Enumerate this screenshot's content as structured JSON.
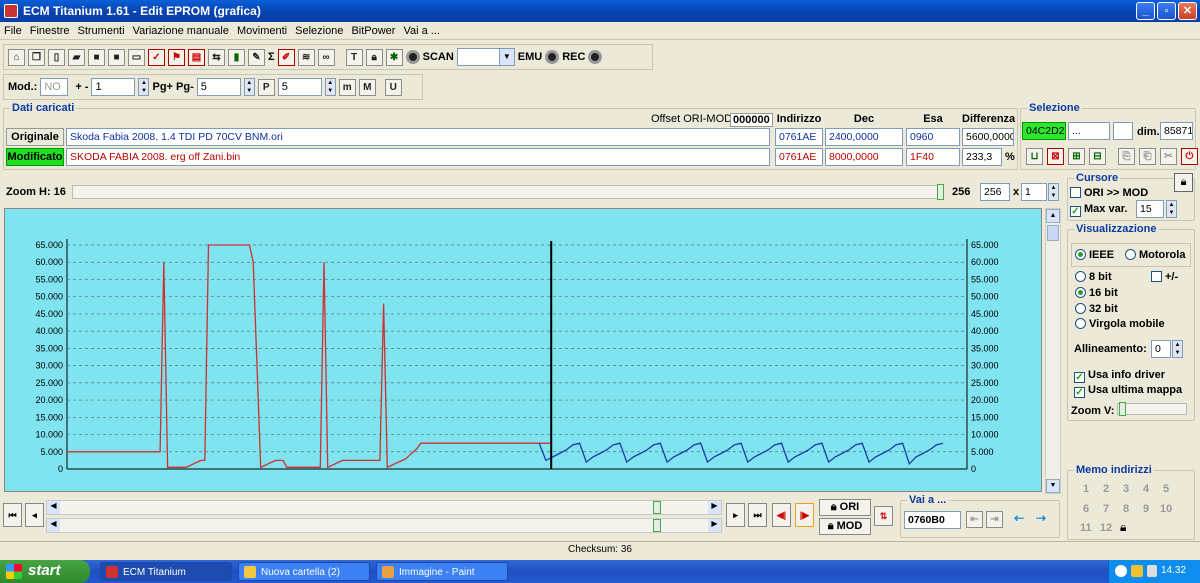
{
  "window": {
    "title": "ECM Titanium 1.61 - Edit EPROM (grafica)"
  },
  "menu": [
    "File",
    "Finestre",
    "Strumenti",
    "Variazione manuale",
    "Movimenti",
    "Selezione",
    "BitPower",
    "Vai a ..."
  ],
  "toolbar1": {
    "scan": "SCAN",
    "emu": "EMU",
    "rec": "REC",
    "sigma": "Σ"
  },
  "toolbar2": {
    "mod_label": "Mod.:",
    "mod_value": "NO",
    "plusminus": "+ -",
    "step_value": "1",
    "pg_label": "Pg+ Pg-",
    "pg_value": "5",
    "p_value": "5",
    "m_btn": "m",
    "M_btn": "M",
    "U_btn": "U",
    "P_btn": "P"
  },
  "dati": {
    "title": "Dati caricati",
    "offset_label": "Offset ORI-MOD",
    "offset_value": "000000",
    "headers": {
      "indirizzo": "Indirizzo",
      "dec": "Dec",
      "esa": "Esa",
      "diff": "Differenza"
    },
    "originale": {
      "label": "Originale",
      "file": "Skoda Fabia 2008. 1.4 TDI PD 70CV BNM.ori",
      "addr": "0761AE",
      "dec": "2400,0000",
      "esa": "0960",
      "diff": "5600,0000"
    },
    "modificato": {
      "label": "Modificato",
      "file": "SKODA FABIA 2008. erg off Zani.bin",
      "addr": "0761AE",
      "dec": "8000,0000",
      "esa": "1F40",
      "diff": "233,3",
      "pct": "%"
    }
  },
  "selezione": {
    "title": "Selezione",
    "start": "04C2D2",
    "end": "...",
    "dim_label": "dim.",
    "dim_value": "85871"
  },
  "zoom": {
    "label": "Zoom H: 16",
    "value": "256",
    "field": "256",
    "times": "x",
    "mult": "1"
  },
  "cursore": {
    "title": "Cursore",
    "ori_mod": "ORI >> MOD",
    "maxvar": "Max var.",
    "maxvar_value": "15"
  },
  "visualizzazione": {
    "title": "Visualizzazione",
    "ieee": "IEEE",
    "motorola": "Motorola",
    "b8": "8 bit",
    "pm": "+/-",
    "b16": "16 bit",
    "b32": "32 bit",
    "virgola": "Virgola mobile",
    "allineamento": "Allineamento:",
    "allineamento_value": "0",
    "usa_info": "Usa info driver",
    "usa_mappa": "Usa ultima mappa",
    "zoomv": "Zoom V:"
  },
  "memo": {
    "title": "Memo indirizzi",
    "numbers": [
      "1",
      "2",
      "3",
      "4",
      "5",
      "6",
      "7",
      "8",
      "9",
      "10",
      "11",
      "12"
    ]
  },
  "bottom": {
    "ori": "ORI",
    "mod": "MOD",
    "vai_title": "Vai a ...",
    "vai_value": "0760B0"
  },
  "status": {
    "checksum": "Checksum: 36"
  },
  "taskbar": {
    "start": "start",
    "tasks": [
      "ECM Titanium",
      "Nuova cartella (2)",
      "Immagine - Paint"
    ],
    "clock": "14.32"
  },
  "chart_data": {
    "type": "line",
    "ylim": [
      0,
      65000
    ],
    "y_ticks": [
      "0",
      "5.000",
      "10.000",
      "15.000",
      "20.000",
      "25.000",
      "30.000",
      "35.000",
      "40.000",
      "45.000",
      "50.000",
      "55.000",
      "60.000",
      "65.000"
    ],
    "colors": {
      "original": "#d03030",
      "modified": "#1a3aa8",
      "cursor": "#000000",
      "grid": "#4a7a80"
    },
    "cursor_fraction": 0.538,
    "series": [
      {
        "values": [
          5000,
          5000,
          5000,
          5000,
          5000,
          5000,
          5000,
          5000,
          5000,
          5000,
          5000,
          5000,
          5000,
          5000,
          5000,
          5000,
          5000,
          5000,
          5000,
          5000,
          5000,
          5000,
          5000,
          5000,
          5000,
          5000,
          60000,
          500,
          500,
          500,
          500,
          500,
          500,
          1000,
          1500,
          2000,
          2500,
          2500,
          65000,
          65000,
          65000,
          65000,
          65000,
          65000,
          65000,
          65000,
          65000,
          65000,
          65000,
          65000,
          60000,
          30000,
          500,
          1000,
          1500,
          2000,
          2500,
          2500,
          2500,
          500,
          500,
          500,
          500,
          500,
          500,
          500,
          500,
          500,
          500,
          60000,
          500,
          1000,
          1500,
          2000,
          2500,
          2500,
          2500,
          2500,
          2500,
          2500,
          2500,
          2500,
          2500,
          2500,
          2500,
          48000,
          500,
          1000,
          1500,
          2000,
          2500,
          3000,
          4000,
          5000,
          6000,
          7500,
          7500,
          7500,
          7500,
          7500,
          7500,
          7500,
          7500,
          7500,
          7500,
          7500,
          7500,
          7500,
          7500,
          7500,
          7500,
          7500,
          7500,
          7500,
          7500,
          7500,
          7500,
          7500,
          7500,
          7500,
          7500,
          7500,
          7500,
          7500,
          7500,
          7500,
          7500,
          7500,
          7500,
          7500,
          7500
        ]
      },
      {
        "values": [
          7500,
          2500,
          3500,
          4500,
          5500,
          7000,
          7500,
          2000,
          3500,
          4500,
          5500,
          7000,
          7500,
          2000,
          3500,
          4500,
          5500,
          7000,
          7500,
          2000,
          3500,
          4500,
          5500,
          7000,
          7500,
          2000,
          3500,
          4500,
          5500,
          7000,
          7500,
          2000,
          3500,
          4500,
          5500,
          7000,
          7500,
          2000,
          3500,
          4500,
          5500,
          7000,
          7500,
          2000,
          3500,
          4500,
          5500,
          7000,
          7500,
          2000,
          3500,
          4500,
          5500,
          7000,
          7500,
          1500,
          3500,
          4500,
          5500,
          7000,
          7500
        ]
      }
    ]
  }
}
